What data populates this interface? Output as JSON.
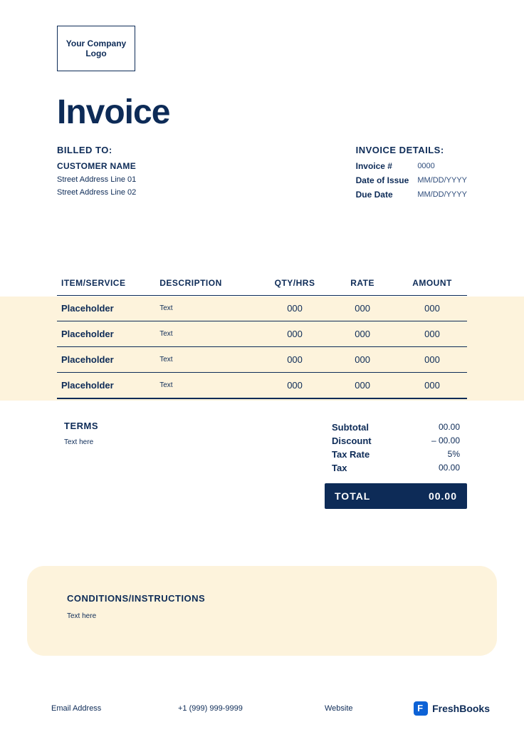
{
  "logo": {
    "text": "Your Company Logo"
  },
  "title": "Invoice",
  "billed": {
    "label": "BILLED TO:",
    "customer": "CUSTOMER NAME",
    "addr1": "Street Address Line 01",
    "addr2": "Street Address Line 02"
  },
  "details": {
    "label": "INVOICE DETAILS:",
    "invoice_no_label": "Invoice #",
    "invoice_no": "0000",
    "date_issue_label": "Date of Issue",
    "date_issue": "MM/DD/YYYY",
    "due_label": "Due Date",
    "due": "MM/DD/YYYY"
  },
  "table": {
    "headers": {
      "item": "ITEM/SERVICE",
      "desc": "DESCRIPTION",
      "qty": "QTY/HRS",
      "rate": "RATE",
      "amount": "AMOUNT"
    },
    "rows": [
      {
        "item": "Placeholder",
        "desc": "Text",
        "qty": "000",
        "rate": "000",
        "amount": "000"
      },
      {
        "item": "Placeholder",
        "desc": "Text",
        "qty": "000",
        "rate": "000",
        "amount": "000"
      },
      {
        "item": "Placeholder",
        "desc": "Text",
        "qty": "000",
        "rate": "000",
        "amount": "000"
      },
      {
        "item": "Placeholder",
        "desc": "Text",
        "qty": "000",
        "rate": "000",
        "amount": "000"
      }
    ]
  },
  "terms": {
    "label": "TERMS",
    "text": "Text here"
  },
  "totals": {
    "subtotal_label": "Subtotal",
    "subtotal": "00.00",
    "discount_label": "Discount",
    "discount": "– 00.00",
    "taxrate_label": "Tax Rate",
    "taxrate": "5%",
    "tax_label": "Tax",
    "tax": "00.00",
    "total_label": "TOTAL",
    "total": "00.00"
  },
  "conditions": {
    "label": "CONDITIONS/INSTRUCTIONS",
    "text": "Text here"
  },
  "footer": {
    "email": "Email Address",
    "phone": "+1 (999) 999-9999",
    "website": "Website",
    "brand": "FreshBooks"
  }
}
